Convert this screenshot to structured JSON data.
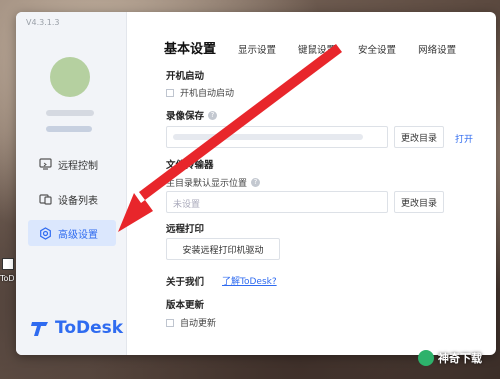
{
  "app": {
    "version": "V4.3.1.3",
    "brand": "ToDesk",
    "accent": "#2f6bf0"
  },
  "sidebar": {
    "items": [
      {
        "label": "远程控制",
        "icon": "remote-control-icon"
      },
      {
        "label": "设备列表",
        "icon": "device-list-icon"
      },
      {
        "label": "高级设置",
        "icon": "gear-icon",
        "active": true
      }
    ]
  },
  "tabs": [
    {
      "label": "基本设置",
      "active": true
    },
    {
      "label": "显示设置"
    },
    {
      "label": "键鼠设置"
    },
    {
      "label": "安全设置"
    },
    {
      "label": "网络设置"
    }
  ],
  "settings": {
    "startup": {
      "title": "开机启动",
      "option": "开机自动启动"
    },
    "recording": {
      "title": "录像保存",
      "change_button": "更改目录",
      "open_link": "打开"
    },
    "file_transfer": {
      "title": "文件传输器",
      "subtitle": "主目录默认显示位置",
      "placeholder": "未设置",
      "change_button": "更改目录"
    },
    "remote_print": {
      "title": "远程打印",
      "install_button": "安装远程打印机驱动"
    },
    "about": {
      "title": "关于我们",
      "link": "了解ToDesk?"
    },
    "update": {
      "title": "版本更新",
      "option": "自动更新"
    }
  },
  "desktop": {
    "icon_label": "ToD"
  },
  "watermark": {
    "text": "神奇下载"
  }
}
